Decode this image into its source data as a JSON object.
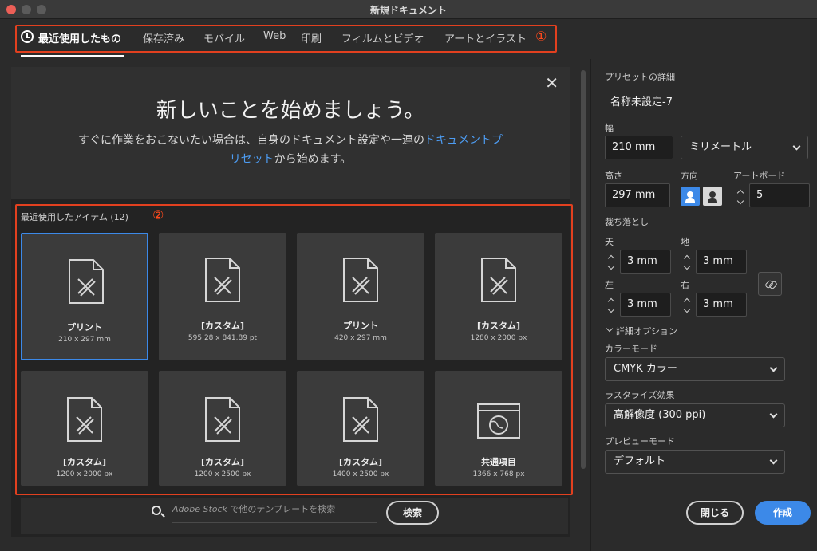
{
  "window": {
    "title": "新規ドキュメント"
  },
  "tabs": [
    {
      "label": "最近使用したもの"
    },
    {
      "label": "保存済み"
    },
    {
      "label": "モバイル"
    },
    {
      "label": "Web"
    },
    {
      "label": "印刷"
    },
    {
      "label": "フィルムとビデオ"
    },
    {
      "label": "アートとイラスト"
    }
  ],
  "annotations": {
    "tabs_marker": "①",
    "recent_marker": "②"
  },
  "hero": {
    "close": "✕",
    "title": "新しいことを始めましょう。",
    "body_before": "すぐに作業をおこないたい場合は、自身のドキュメント設定や一連の",
    "body_link": "ドキュメントプリセット",
    "body_after": "から始めます。"
  },
  "recent": {
    "label": "最近使用したアイテム (12)",
    "items": [
      {
        "name": "プリント",
        "size": "210 x 297 mm"
      },
      {
        "name": "[カスタム]",
        "size": "595.28 x 841.89 pt"
      },
      {
        "name": "プリント",
        "size": "420 x 297 mm"
      },
      {
        "name": "[カスタム]",
        "size": "1280 x 2000 px"
      },
      {
        "name": "[カスタム]",
        "size": "1200 x 2000 px"
      },
      {
        "name": "[カスタム]",
        "size": "1200 x 2500 px"
      },
      {
        "name": "[カスタム]",
        "size": "1400 x 2500 px"
      },
      {
        "name": "共通項目",
        "size": "1366 x 768 px"
      }
    ]
  },
  "search": {
    "placeholder_brand": "Adobe Stock",
    "placeholder_rest": " で他のテンプレートを検索",
    "button": "検索"
  },
  "preset": {
    "section_label": "プリセットの詳細",
    "name": "名称未設定-7",
    "width_label": "幅",
    "width": "210 mm",
    "unit": "ミリメートル",
    "height_label": "高さ",
    "height": "297 mm",
    "orientation_label": "方向",
    "artboard_label": "アートボード",
    "artboards": "5",
    "bleed_label": "裁ち落とし",
    "bleed_top_label": "天",
    "bleed_top": "3 mm",
    "bleed_bottom_label": "地",
    "bleed_bottom": "3 mm",
    "bleed_left_label": "左",
    "bleed_left": "3 mm",
    "bleed_right_label": "右",
    "bleed_right": "3 mm",
    "advanced_label": "詳細オプション",
    "color_mode_label": "カラーモード",
    "color_mode": "CMYK カラー",
    "raster_label": "ラスタライズ効果",
    "raster": "高解像度 (300 ppi)",
    "preview_label": "プレビューモード",
    "preview": "デフォルト"
  },
  "footer": {
    "close": "閉じる",
    "create": "作成"
  },
  "colors": {
    "accent": "#3c89e8",
    "annotation": "#e2401f"
  }
}
